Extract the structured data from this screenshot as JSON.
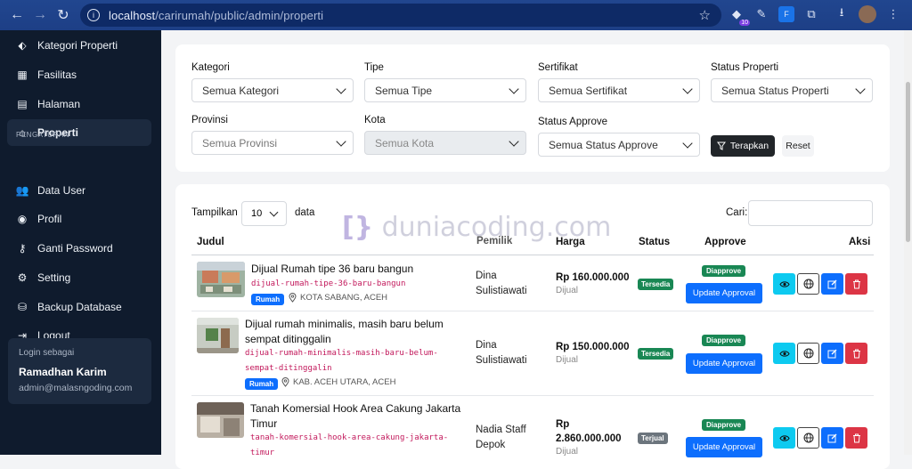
{
  "browser": {
    "url_host": "localhost",
    "url_path": "/carirumah/public/admin/properti",
    "extension_badge": "10"
  },
  "sidebar": {
    "items": [
      {
        "label": "Kategori Properti",
        "icon": "tag-icon"
      },
      {
        "label": "Fasilitas",
        "icon": "grid-icon"
      },
      {
        "label": "Halaman",
        "icon": "file-icon"
      },
      {
        "label": "Properti",
        "icon": "home-icon"
      }
    ],
    "section_label": "PENGATURAN",
    "settings_items": [
      {
        "label": "Data User",
        "icon": "users-icon"
      },
      {
        "label": "Profil",
        "icon": "user-circle-icon"
      },
      {
        "label": "Ganti Password",
        "icon": "key-icon"
      },
      {
        "label": "Setting",
        "icon": "gear-icon"
      },
      {
        "label": "Backup Database",
        "icon": "database-icon"
      },
      {
        "label": "Logout",
        "icon": "logout-icon"
      }
    ],
    "login": {
      "caption": "Login sebagai",
      "name": "Ramadhan Karim",
      "email": "admin@malasngoding.com"
    }
  },
  "filters": {
    "kategori": {
      "label": "Kategori",
      "value": "Semua Kategori"
    },
    "tipe": {
      "label": "Tipe",
      "value": "Semua Tipe"
    },
    "sertifikat": {
      "label": "Sertifikat",
      "value": "Semua Sertifikat"
    },
    "status_properti": {
      "label": "Status Properti",
      "value": "Semua Status Properti"
    },
    "provinsi": {
      "label": "Provinsi",
      "value": "Semua Provinsi"
    },
    "kota": {
      "label": "Kota",
      "value": "Semua Kota"
    },
    "status_approve": {
      "label": "Status Approve",
      "value": "Semua Status Approve"
    },
    "apply_label": "Terapkan",
    "reset_label": "Reset"
  },
  "table": {
    "show_label": "Tampilkan",
    "page_length": "10",
    "data_label": "data",
    "search_label": "Cari:",
    "watermark": "duniacoding.com",
    "headers": {
      "judul": "Judul",
      "pemilik": "Pemilik",
      "harga": "Harga",
      "status": "Status",
      "approve": "Approve",
      "aksi": "Aksi"
    },
    "rows": [
      {
        "title": "Dijual Rumah tipe 36 baru bangun",
        "slug": "dijual-rumah-tipe-36-baru-bangun",
        "type": "Rumah",
        "location": "KOTA SABANG, ACEH",
        "owner_line1": "Dina",
        "owner_line2": "Sulistiawati",
        "price": "Rp 160.000.000",
        "sale": "Dijual",
        "status": "Tersedia",
        "approve": "Diapprove",
        "update_label": "Update Approval"
      },
      {
        "title_line1": "Dijual rumah minimalis, masih baru belum",
        "title_line2": "sempat ditinggalin",
        "slug_line1": "dijual-rumah-minimalis-masih-baru-belum-",
        "slug_line2": "sempat-ditinggalin",
        "type": "Rumah",
        "location": "KAB. ACEH UTARA, ACEH",
        "owner_line1": "Dina",
        "owner_line2": "Sulistiawati",
        "price": "Rp 150.000.000",
        "sale": "Dijual",
        "status": "Tersedia",
        "approve": "Diapprove",
        "update_label": "Update Approval"
      },
      {
        "title_line1": "Tanah Komersial Hook Area Cakung Jakarta",
        "title_line2": "Timur",
        "slug_line1": "tanah-komersial-hook-area-cakung-jakarta-",
        "slug_line2": "timur",
        "owner_line1": "Nadia Staff",
        "owner_line2": "Depok",
        "price_line1": "Rp",
        "price_line2": "2.860.000.000",
        "sale": "Dijual",
        "status": "Terjual",
        "approve": "Diapprove",
        "update_label": "Update Approval"
      }
    ]
  },
  "colors": {
    "sidebar_bg": "#0f1b2d",
    "primary": "#0d6efd",
    "success": "#198754",
    "danger": "#dc3545",
    "info": "#0dcaf0",
    "secondary": "#6c757d"
  }
}
